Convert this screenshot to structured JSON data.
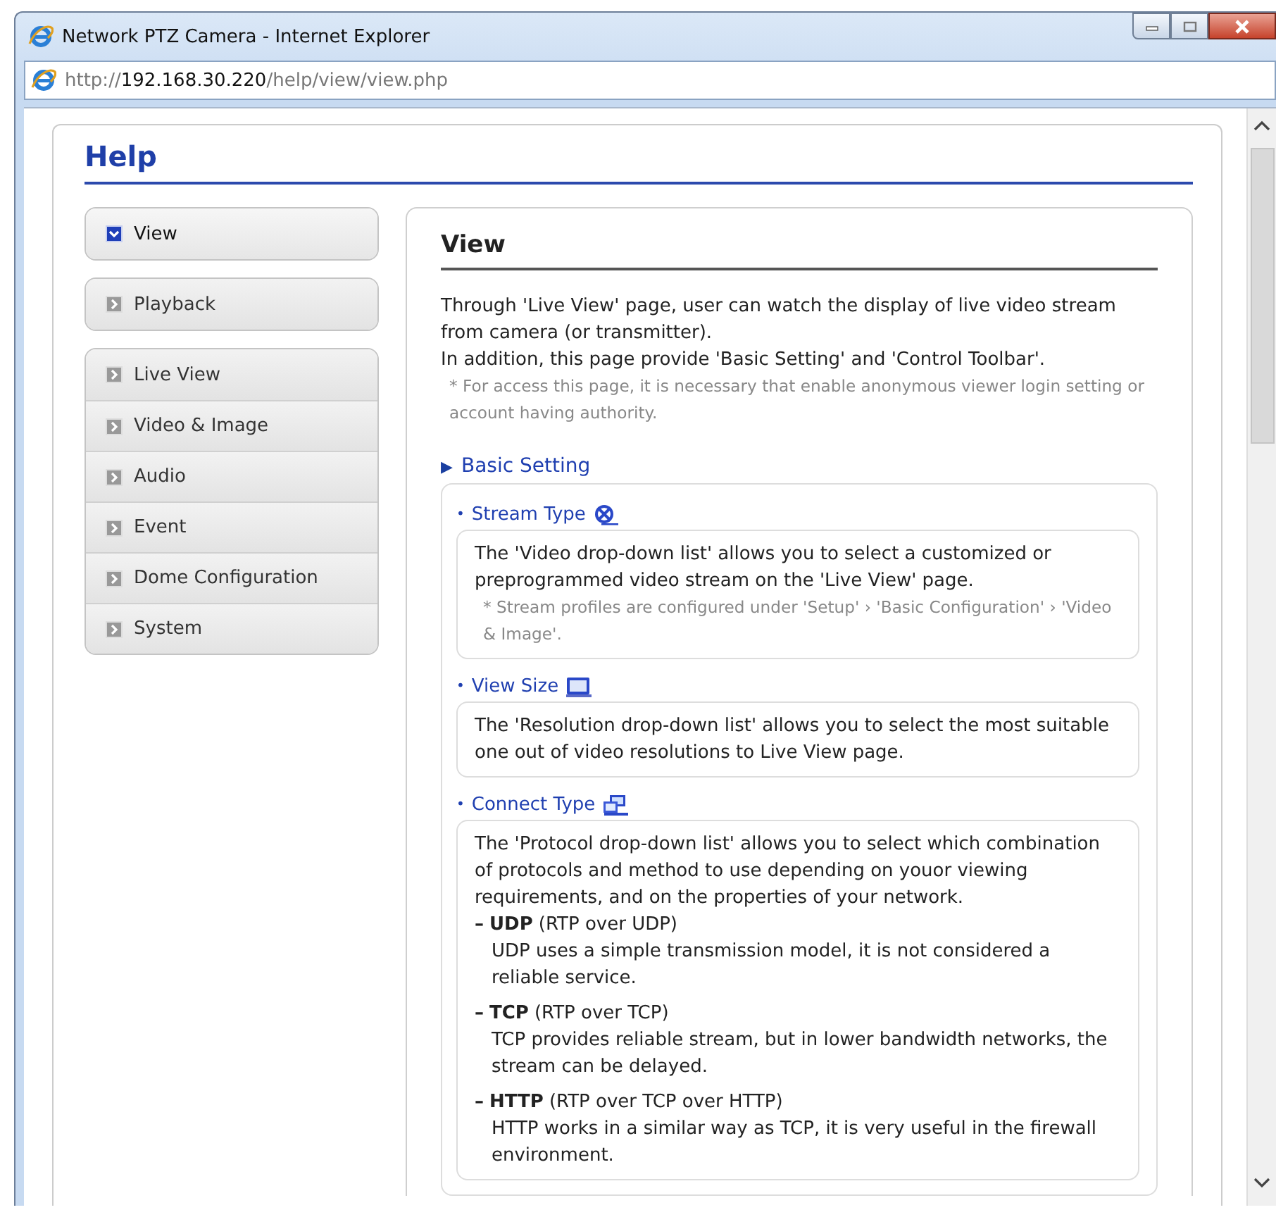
{
  "window": {
    "title": "Network PTZ Camera - Internet Explorer"
  },
  "address_bar": {
    "scheme": "http://",
    "host": "192.168.30.220",
    "path": "/help/view/view.php"
  },
  "page": {
    "title": "Help",
    "sidebar": {
      "groups": [
        {
          "items": [
            {
              "label": "View",
              "selected": true
            }
          ]
        },
        {
          "items": [
            {
              "label": "Playback",
              "selected": false
            }
          ]
        },
        {
          "items": [
            {
              "label": "Live View",
              "selected": false
            },
            {
              "label": "Video & Image",
              "selected": false
            },
            {
              "label": "Audio",
              "selected": false
            },
            {
              "label": "Event",
              "selected": false
            },
            {
              "label": "Dome Configuration",
              "selected": false
            },
            {
              "label": "System",
              "selected": false
            }
          ]
        }
      ]
    },
    "content": {
      "heading": "View",
      "intro": [
        "Through 'Live View' page, user can watch the display of live video stream from camera (or transmitter).",
        "In addition, this page provide 'Basic Setting' and 'Control Toolbar'."
      ],
      "note": "* For access this page, it is necessary that enable anonymous viewer login setting or account having authority.",
      "sections": [
        {
          "marker": "▶",
          "title": "Basic Setting",
          "items": [
            {
              "bullet": "•",
              "title": "Stream Type",
              "text": "The 'Video drop-down list' allows you to select a customized or preprogrammed video stream on the 'Live View' page.",
              "note": "* Stream profiles are configured under 'Setup' › 'Basic Configuration' › 'Video & Image'."
            },
            {
              "bullet": "•",
              "title": "View Size",
              "text": "The 'Resolution drop-down list' allows you to select the most suitable one out of video resolutions to Live View page."
            },
            {
              "bullet": "•",
              "title": "Connect Type",
              "text": "The 'Protocol drop-down list' allows you to select which combination of protocols and method to use depending on youor viewing requirements, and on the properties of your network.",
              "options": [
                {
                  "marker": "–",
                  "name": "UDP",
                  "detail": "(RTP over UDP)",
                  "text": "UDP uses a simple transmission model, it is not considered a reliable service."
                },
                {
                  "marker": "–",
                  "name": "TCP",
                  "detail": "(RTP over TCP)",
                  "text": "TCP provides reliable stream, but in lower bandwidth networks, the stream can be delayed."
                },
                {
                  "marker": "–",
                  "name": "HTTP",
                  "detail": "(RTP over TCP over HTTP)",
                  "text": "HTTP works in a similar way as TCP, it is very useful in the firewall environment."
                }
              ]
            }
          ]
        }
      ]
    }
  }
}
